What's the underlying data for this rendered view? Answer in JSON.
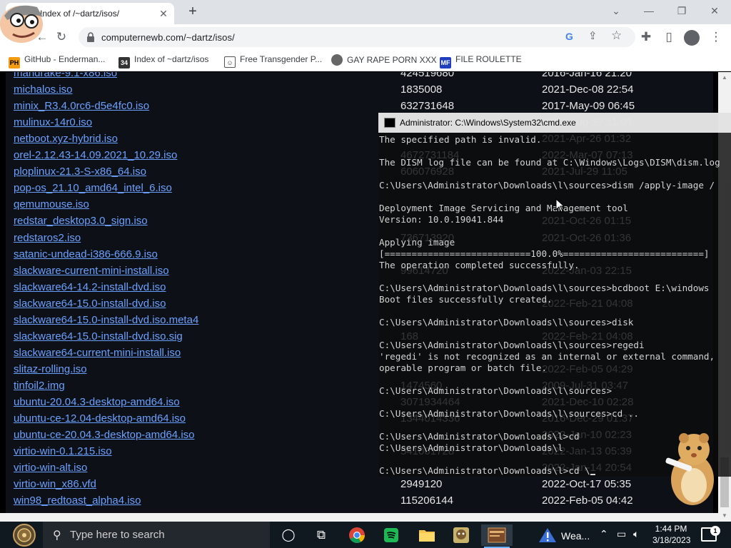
{
  "browser": {
    "tab_title": "Index of /~dartz/isos/",
    "tab_close": "✕",
    "new_tab": "+",
    "url": "computernewb.com/~dartz/isos/",
    "bookmarks": [
      {
        "label": "GitHub - Enderman...",
        "favicon": "PH"
      },
      {
        "label": "Index of ~dartz/isos",
        "favicon": "34"
      },
      {
        "label": "Free Transgender P...",
        "favicon": "☺"
      },
      {
        "label": "GAY RAPE PORN XXX",
        "favicon": ""
      },
      {
        "label": "FILE ROULETTE",
        "favicon": "MF"
      }
    ]
  },
  "listing": {
    "rows": [
      {
        "name": "mandrake-9.1-x86.iso",
        "size": "424519680",
        "date": "2016-Jan-16 21:20"
      },
      {
        "name": "michalos.iso",
        "size": "1835008",
        "date": "2021-Dec-08 22:54"
      },
      {
        "name": "minix_R3.4.0rc6-d5e4fc0.iso",
        "size": "632731648",
        "date": "2017-May-09 06:45"
      },
      {
        "name": "mulinux-14r0.iso",
        "size": "",
        "date": "2017-Aug-27 11:01"
      },
      {
        "name": "netboot.xyz-hybrid.iso",
        "size": "",
        "date": "2021-Apr-26 01:32"
      },
      {
        "name": "orel-2.12.43-14.09.2021_10.29.iso",
        "size": "4672731184",
        "date": "2022-Mar-07 07:13"
      },
      {
        "name": "ploplinux-21.3-S-x86_64.iso",
        "size": "606076928",
        "date": "2021-Jul-29 11:05"
      },
      {
        "name": "pop-os_21.10_amd64_intel_6.iso",
        "size": "",
        "date": ""
      },
      {
        "name": "qemumouse.iso",
        "size": "",
        "date": ""
      },
      {
        "name": "redstar_desktop3.0_sign.iso",
        "size": "",
        "date": "2021-Oct-26 01:15"
      },
      {
        "name": "redstaros2.iso",
        "size": "736713920",
        "date": "2021-Oct-26 01:36"
      },
      {
        "name": "satanic-undead-i386-666.9.iso",
        "size": "",
        "date": ""
      },
      {
        "name": "slackware-current-mini-install.iso",
        "size": "99614720",
        "date": "2022-Jan-03 22:15"
      },
      {
        "name": "slackware64-14.2-install-dvd.iso",
        "size": "",
        "date": ""
      },
      {
        "name": "slackware64-15.0-install-dvd.iso",
        "size": "",
        "date": "2022-Feb-21 04:08"
      },
      {
        "name": "slackware64-15.0-install-dvd.iso.meta4",
        "size": "",
        "date": ""
      },
      {
        "name": "slackware64-15.0-install-dvd.iso.sig",
        "size": "168",
        "date": "2022-Feb-21 04:08"
      },
      {
        "name": "slackware64-current-mini-install.iso",
        "size": "",
        "date": ""
      },
      {
        "name": "slitaz-rolling.iso",
        "size": "",
        "date": "2022-Feb-05 04:29"
      },
      {
        "name": "tinfoil2.img",
        "size": "1474560",
        "date": "2009-Jul-31 03:47"
      },
      {
        "name": "ubuntu-20.04.3-desktop-amd64.iso",
        "size": "3071934464",
        "date": "2021-Dec-10 02:28"
      },
      {
        "name": "ubuntu-ce-12.04-desktop-amd64.iso",
        "size": "1344014336",
        "date": "2016-Dec-29 01:37"
      },
      {
        "name": "ubuntu-ce-20.04.3-desktop-amd64.iso",
        "size": "",
        "date": "2022-Jan-10 02:23"
      },
      {
        "name": "virtio-win-0.1.215.iso",
        "size": "541001728",
        "date": "2022-Jan-13 05:39"
      },
      {
        "name": "virtio-win-alt.iso",
        "size": "",
        "date": "2022-Jan-14 20:54"
      },
      {
        "name": "virtio-win_x86.vfd",
        "size": "2949120",
        "date": "2022-Oct-17 05:35"
      },
      {
        "name": "win98_redtoast_alpha4.iso",
        "size": "115206144",
        "date": "2022-Feb-05 04:42"
      }
    ]
  },
  "cmd": {
    "title": "Administrator: C:\\Windows\\System32\\cmd.exe",
    "lines": [
      "The specified path is invalid.",
      "",
      "The DISM log file can be found at C:\\Windows\\Logs\\DISM\\dism.log",
      "",
      "C:\\Users\\Administrator\\Downloads\\l\\sources>dism /apply-image /",
      "",
      "Deployment Image Servicing and Management tool",
      "Version: 10.0.19041.844",
      "",
      "Applying image",
      "[===========================100.0%==========================]",
      "The operation completed successfully.",
      "",
      "C:\\Users\\Administrator\\Downloads\\l\\sources>bcdboot E:\\windows",
      "Boot files successfully created.",
      "",
      "C:\\Users\\Administrator\\Downloads\\l\\sources>disk",
      "",
      "C:\\Users\\Administrator\\Downloads\\l\\sources>regedi",
      "'regedi' is not recognized as an internal or external command,",
      "operable program or batch file.",
      "",
      "C:\\Users\\Administrator\\Downloads\\l\\sources>",
      "",
      "C:\\Users\\Administrator\\Downloads\\l\\sources>cd ..",
      "",
      "C:\\Users\\Administrator\\Downloads\\l>cd",
      "C:\\Users\\Administrator\\Downloads\\l",
      ""
    ],
    "prompt_line": "C:\\Users\\Administrator\\Downloads\\l>cd \\"
  },
  "taskbar": {
    "search_placeholder": "Type here to search",
    "weather_label": "Wea...",
    "time": "1:44 PM",
    "date": "3/18/2023",
    "notification_count": "1"
  },
  "icons": {
    "search": "search-icon",
    "cortana": "cortana-icon",
    "task_view": "task-view-icon",
    "chrome": "chrome-icon",
    "spotify": "spotify-icon",
    "explorer": "folder-icon",
    "weather": "warning-icon"
  }
}
